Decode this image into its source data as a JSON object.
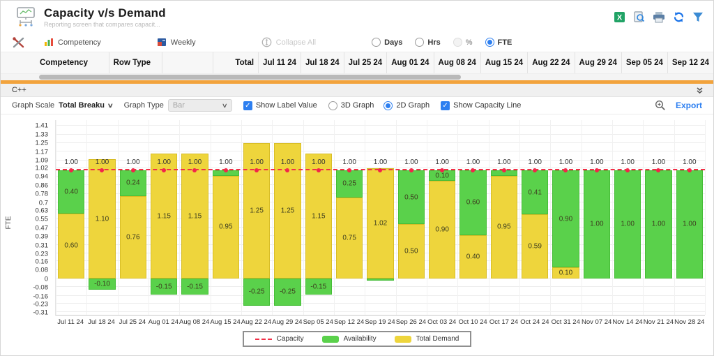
{
  "header": {
    "title": "Capacity v/s Demand",
    "subtitle": "Reporting screen that compares capacit...",
    "action_icons": [
      "excel-export-icon",
      "preview-icon",
      "print-icon",
      "refresh-icon",
      "filter-icon"
    ]
  },
  "toolbar": {
    "views": [
      {
        "label": "Competency",
        "icon": "competency-chart-icon",
        "disabled": false
      },
      {
        "label": "Weekly",
        "icon": "weekly-calendar-icon",
        "disabled": false
      },
      {
        "label": "Collapse All",
        "icon": "collapse-all-icon",
        "disabled": true
      }
    ],
    "unit_radios": [
      {
        "label": "Days",
        "checked": false,
        "disabled": false
      },
      {
        "label": "Hrs",
        "checked": false,
        "disabled": false
      },
      {
        "label": "%",
        "checked": false,
        "disabled": true
      },
      {
        "label": "FTE",
        "checked": true,
        "disabled": false
      }
    ]
  },
  "table": {
    "columns": {
      "competency": "Competency",
      "row_type": "Row Type",
      "total": "Total"
    },
    "date_columns": [
      "Jul 11 24",
      "Jul 18 24",
      "Jul 25 24",
      "Aug 01 24",
      "Aug 08 24",
      "Aug 15 24",
      "Aug 22 24",
      "Aug 29 24",
      "Sep 05 24",
      "Sep 12 24"
    ]
  },
  "group_row": {
    "label": "C++"
  },
  "graph_controls": {
    "graph_scale_label": "Graph Scale",
    "graph_scale_value": "Total Breaku",
    "graph_type_label": "Graph Type",
    "graph_type_value": "Bar",
    "show_label_value_label": "Show Label Value",
    "show_label_value_checked": true,
    "graph_3d_label": "3D Graph",
    "graph_3d_selected": false,
    "graph_2d_label": "2D Graph",
    "graph_2d_selected": true,
    "show_capacity_line_label": "Show Capacity Line",
    "show_capacity_line_checked": true,
    "export_label": "Export"
  },
  "chart_data": {
    "type": "bar",
    "stacked": true,
    "title": "",
    "xlabel": "",
    "ylabel": "FTE",
    "categories": [
      "Jul 11 24",
      "Jul 18 24",
      "Jul 25 24",
      "Aug 01 24",
      "Aug 08 24",
      "Aug 15 24",
      "Aug 22 24",
      "Aug 29 24",
      "Sep 05 24",
      "Sep 12 24",
      "Sep 19 24",
      "Sep 26 24",
      "Oct 03 24",
      "Oct 10 24",
      "Oct 17 24",
      "Oct 24 24",
      "Oct 31 24",
      "Nov 07 24",
      "Nov 14 24",
      "Nov 21 24",
      "Nov 28 24"
    ],
    "series": [
      {
        "name": "Total Demand",
        "color": "#eed53c",
        "border": "#d8bd26",
        "values": [
          0.6,
          1.1,
          0.76,
          1.15,
          1.15,
          0.95,
          1.25,
          1.25,
          1.15,
          0.75,
          1.02,
          0.5,
          0.9,
          0.4,
          0.95,
          0.59,
          0.1,
          0,
          0,
          0,
          0
        ]
      },
      {
        "name": "Availability",
        "color": "#5ad14b",
        "border": "#45bd37",
        "values": [
          0.4,
          -0.1,
          0.24,
          -0.15,
          -0.15,
          0.05,
          -0.25,
          -0.25,
          -0.15,
          0.25,
          -0.02,
          0.5,
          0.1,
          0.6,
          0.05,
          0.41,
          0.9,
          1.0,
          1.0,
          1.0,
          1.0
        ]
      }
    ],
    "bar_totals": [
      1.0,
      1.0,
      1.0,
      1.0,
      1.0,
      1.0,
      1.0,
      1.0,
      1.0,
      1.0,
      1.0,
      1.0,
      1.0,
      1.0,
      1.0,
      1.0,
      1.0,
      1.0,
      1.0,
      1.0,
      1.0
    ],
    "capacity_line": 1.0,
    "capacity_color": "#f23047",
    "y_ticks": [
      "1.41",
      "1.33",
      "1.25",
      "1.17",
      "1.09",
      "1.02",
      "0.94",
      "0.86",
      "0.78",
      "0.7",
      "0.63",
      "0.55",
      "0.47",
      "0.39",
      "0.31",
      "0.23",
      "0.16",
      "0.08",
      "0",
      "-0.08",
      "-0.16",
      "-0.23",
      "-0.31"
    ],
    "ylim": [
      -0.31,
      1.41
    ],
    "label_min_abs": 0.1,
    "grid": true,
    "legend_position": "bottom"
  },
  "legend": {
    "items": [
      {
        "label": "Capacity",
        "swatch": "dashed-line",
        "color": "#f23047"
      },
      {
        "label": "Availability",
        "swatch": "box",
        "color": "#5ad14b"
      },
      {
        "label": "Total Demand",
        "swatch": "box",
        "color": "#eed53c"
      }
    ]
  },
  "colors": {
    "accent_blue": "#2d7ff0",
    "orange_bar": "#f2a33c",
    "excel_green": "#217346"
  }
}
